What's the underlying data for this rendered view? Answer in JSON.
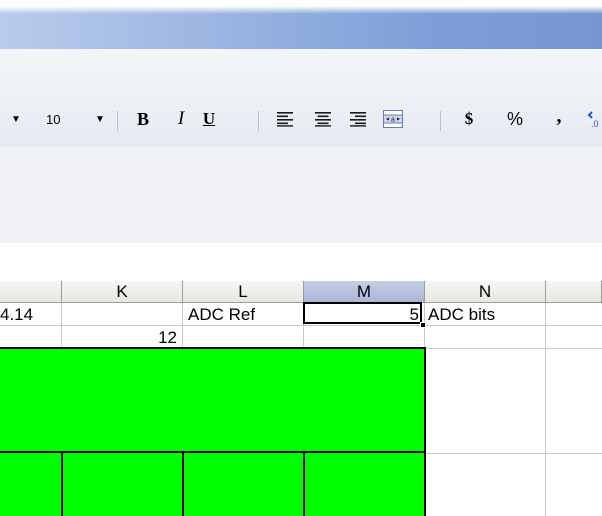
{
  "window": {
    "accent_color": "#7896d0"
  },
  "toolbar": {
    "font_size": "10",
    "bold_label": "B",
    "italic_label": "I",
    "underline_label": "U",
    "currency_label": "$",
    "percent_label": "%",
    "comma_label": ",",
    "icons": [
      "dropdown-arrow-icon",
      "align-left-icon",
      "align-center-icon",
      "align-right-icon",
      "merge-center-icon",
      "increase-decimal-icon"
    ]
  },
  "sheet": {
    "column_headers": [
      "K",
      "L",
      "M",
      "N"
    ],
    "selected_column": "M",
    "cells": {
      "J_row1": "4.14",
      "L_row1": "ADC Ref",
      "M_row1": "5",
      "N_row1": "ADC bits",
      "K_row2": "12"
    },
    "fill_color": "#00ff00"
  }
}
